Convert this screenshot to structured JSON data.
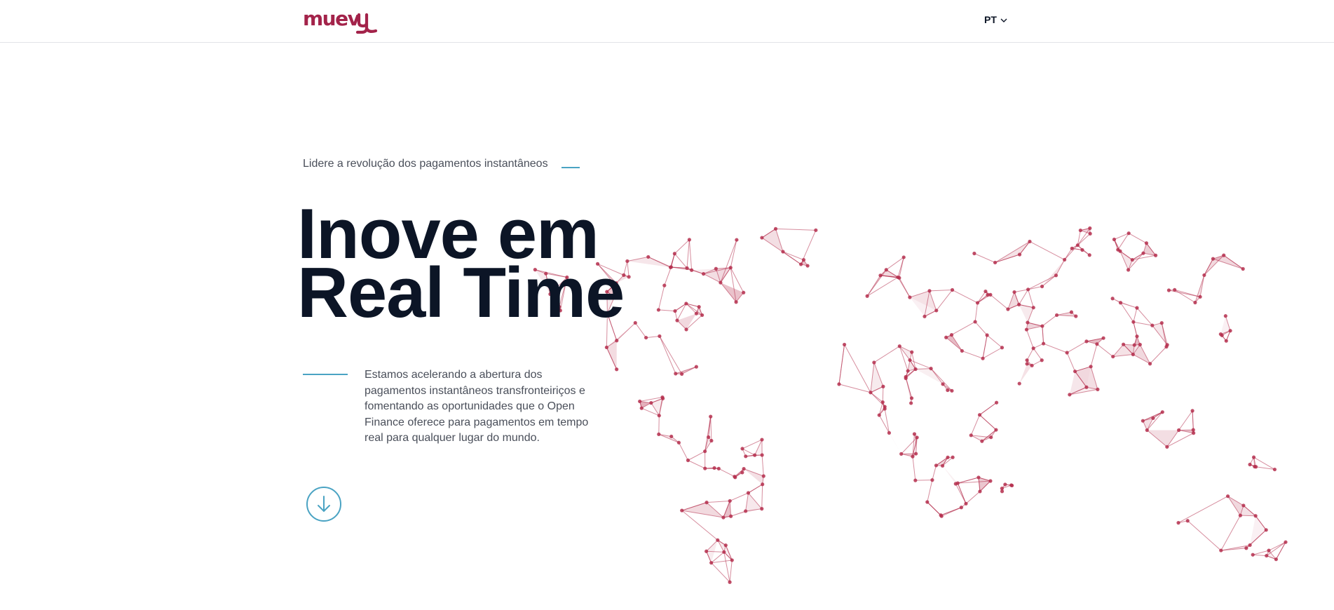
{
  "brand": {
    "logo_text": "muevy",
    "color": "#a3234a"
  },
  "header": {
    "language": "PT",
    "language_icon": "chevron-down-icon"
  },
  "hero": {
    "eyebrow": "Lidere a revolução dos pagamentos instantâneos",
    "headline_line1": "Inove em",
    "headline_line2": "Real Time",
    "description": "Estamos acelerando a abertura dos pagamentos instantâneos transfronteiriços e fomentando as oportunidades que o Open Finance oferece para pagamentos em tempo real para qualquer lugar do mundo.",
    "scroll_icon": "arrow-down-icon"
  },
  "colors": {
    "accent": "#4aa3c3",
    "headline": "#0c1526",
    "map": "#b5304f"
  }
}
